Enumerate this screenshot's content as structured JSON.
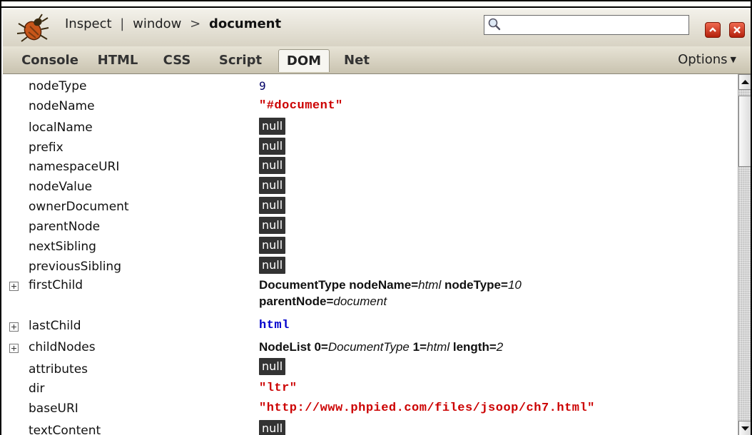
{
  "toolbar": {
    "breadcrumb": {
      "first": "Inspect",
      "sep1": "|",
      "second": "window",
      "sep2": ">",
      "current": "document"
    },
    "search_value": ""
  },
  "tabs": [
    "Console",
    "HTML",
    "CSS",
    "Script",
    "DOM",
    "Net"
  ],
  "active_tab": "DOM",
  "options_label": "Options",
  "rows": {
    "nodeType": {
      "name": "nodeType",
      "value": "9"
    },
    "nodeName": {
      "name": "nodeName",
      "value": "\"#document\""
    },
    "localName": {
      "name": "localName",
      "value": "null"
    },
    "prefix": {
      "name": "prefix",
      "value": "null"
    },
    "namespaceURI": {
      "name": "namespaceURI",
      "value": "null"
    },
    "nodeValue": {
      "name": "nodeValue",
      "value": "null"
    },
    "ownerDocument": {
      "name": "ownerDocument",
      "value": "null"
    },
    "parentNode": {
      "name": "parentNode",
      "value": "null"
    },
    "nextSibling": {
      "name": "nextSibling",
      "value": "null"
    },
    "previousSibling": {
      "name": "previousSibling",
      "value": "null"
    },
    "firstChild": {
      "name": "firstChild",
      "type": "DocumentType",
      "k1": "nodeName=",
      "v1": "html",
      "k2": "nodeType=",
      "v2": "10",
      "k3": "parentNode=",
      "v3": "document"
    },
    "lastChild": {
      "name": "lastChild",
      "value": "html"
    },
    "childNodes": {
      "name": "childNodes",
      "type": "NodeList",
      "k1": "0=",
      "v1": "DocumentType",
      "k2": "1=",
      "v2": "html",
      "k3": "length=",
      "v3": "2"
    },
    "attributes": {
      "name": "attributes",
      "value": "null"
    },
    "dir": {
      "name": "dir",
      "value": "\"ltr\""
    },
    "baseURI": {
      "name": "baseURI",
      "value": "\"http://www.phpied.com/files/jsoop/ch7.html\""
    },
    "textContent": {
      "name": "textContent",
      "value": "null"
    }
  },
  "colors": {
    "string": "#cc0000",
    "object": "#0000cc",
    "null_bg": "#333333",
    "close_button": "#c8341c"
  },
  "icons": [
    "firebug-icon",
    "magnifier-icon",
    "minimize-icon",
    "close-icon",
    "expand-icon"
  ]
}
